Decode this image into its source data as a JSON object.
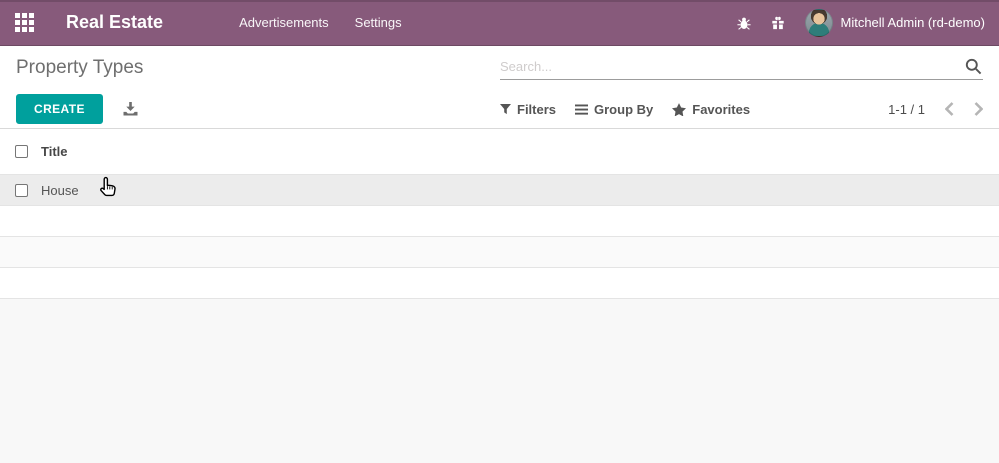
{
  "navbar": {
    "app_name": "Real Estate",
    "menus": [
      {
        "label": "Advertisements"
      },
      {
        "label": "Settings"
      }
    ],
    "user_name": "Mitchell Admin (rd-demo)"
  },
  "page": {
    "title": "Property Types"
  },
  "search": {
    "placeholder": "Search..."
  },
  "control_panel": {
    "create_label": "CREATE",
    "filters_label": "Filters",
    "group_by_label": "Group By",
    "favorites_label": "Favorites",
    "pager": "1-1 / 1"
  },
  "table": {
    "columns": [
      {
        "label": "Title"
      }
    ],
    "rows": [
      {
        "title": "House"
      }
    ]
  },
  "icons": {
    "apps_menu": "grid-3x3",
    "debug": "bug",
    "rewards": "gift",
    "search": "magnifier",
    "export": "download-tray",
    "filters": "funnel",
    "group_by": "horizontal-bars",
    "favorites": "star",
    "pager_previous": "chevron-left",
    "pager_next": "chevron-right",
    "mouse": "hand-pointer"
  },
  "colors": {
    "brand_purple": "#875A7B",
    "primary_teal": "#00A09D",
    "hover_row": "#ececec",
    "muted_background": "#f8f8f8"
  }
}
